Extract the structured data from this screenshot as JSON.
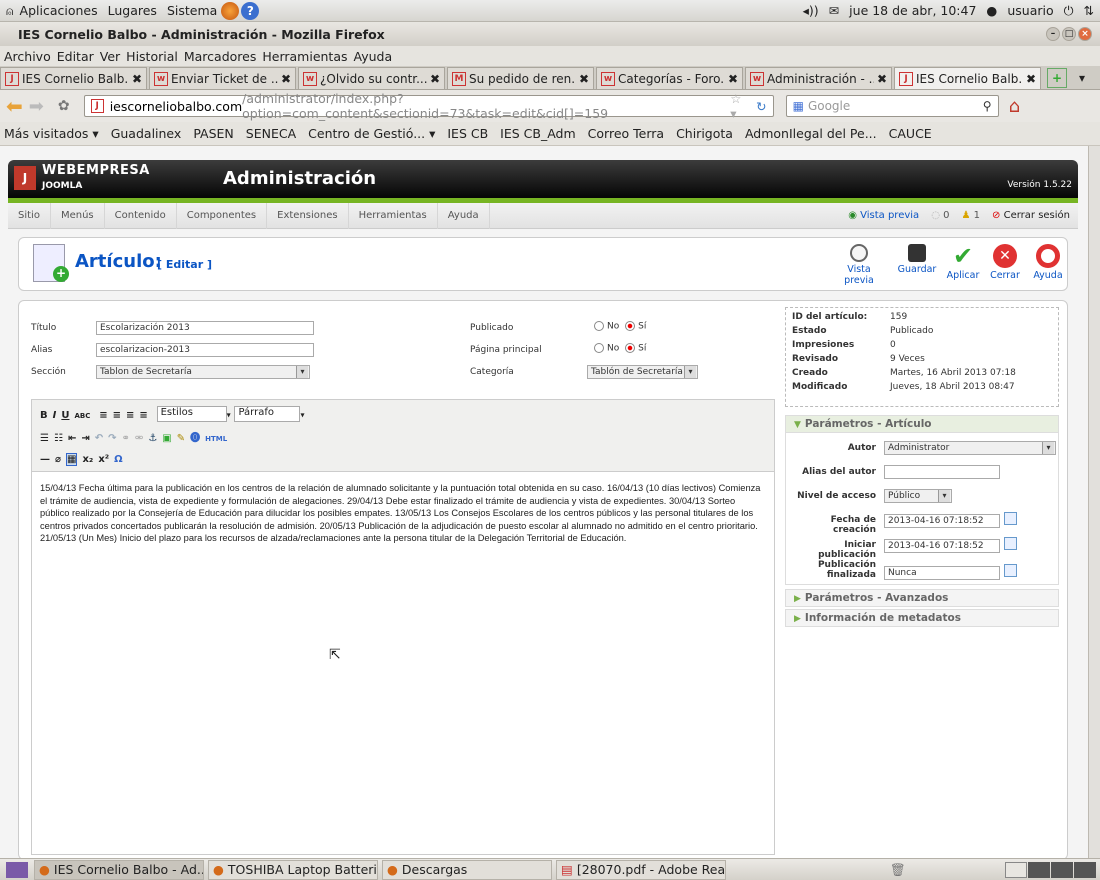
{
  "gnome_panel": {
    "apps": "Aplicaciones",
    "places": "Lugares",
    "system": "Sistema",
    "datetime": "jue 18 de abr, 10:47",
    "user": "usuario"
  },
  "window": {
    "title": "IES Cornelio Balbo - Administración - Mozilla Firefox"
  },
  "firefox_menu": [
    "Archivo",
    "Editar",
    "Ver",
    "Historial",
    "Marcadores",
    "Herramientas",
    "Ayuda"
  ],
  "tabs": [
    "IES Cornelio Balb...",
    "Enviar Ticket de ...",
    "¿Olvido su contr...",
    "Su pedido de ren...",
    "Categorías - Foro...",
    "Administración - ...",
    "IES Cornelio Balb..."
  ],
  "nav": {
    "url_host": "iescorneliobalbo.com",
    "url_path": "/administrator/index.php?option=com_content&sectionid=73&task=edit&cid[]=159",
    "search_placeholder": "Google"
  },
  "bookmarks": [
    "Más visitados ▾",
    "Guadalinex",
    "PASEN",
    "SENECA",
    "Centro de Gestió... ▾",
    "IES CB",
    "IES CB_Adm",
    "Correo Terra",
    "Chirigota",
    "AdmonIlegal del Pe...",
    "CAUCE"
  ],
  "joomla": {
    "brand": "WEBEMPRESA",
    "sub": "JOOMLA",
    "header": "Administración",
    "version": "Versión 1.5.22",
    "menu": [
      "Sitio",
      "Menús",
      "Contenido",
      "Componentes",
      "Extensiones",
      "Herramientas",
      "Ayuda"
    ],
    "preview": "Vista previa",
    "count_a": "0",
    "count_b": "1",
    "logout": "Cerrar sesión"
  },
  "toolbar": {
    "title": "Artículo:",
    "edit": "[ Editar ]",
    "buttons": [
      "Vista previa",
      "Guardar",
      "Aplicar",
      "Cerrar",
      "Ayuda"
    ]
  },
  "form": {
    "titulo_label": "Título",
    "titulo": "Escolarización 2013",
    "alias_label": "Alias",
    "alias": "escolarizacion-2013",
    "seccion_label": "Sección",
    "seccion": "Tablon de Secretaría",
    "publicado_label": "Publicado",
    "pagina_label": "Página principal",
    "categoria_label": "Categoría",
    "categoria": "Tablón de Secretaría",
    "no": "No",
    "si": "Sí"
  },
  "editor": {
    "estilos": "Estilos",
    "parrafo": "Párrafo",
    "text": "15/04/13 Fecha última para la publicación en los centros de la relación de alumnado solicitante y la puntuación total obtenida en su caso. 16/04/13  (10 días lectivos) Comienza el trámite de audiencia, vista de expediente y formulación de alegaciones. 29/04/13 Debe estar finalizado el trámite de audiencia y vista de expedientes. 30/04/13 Sorteo público realizado por la Consejería de Educación para dilucidar los posibles empates. 13/05/13 Los Consejos Escolares de los centros públicos y las personal titulares de los centros privados concertados publicarán la resolución de admisión. 20/05/13 Publicación de la adjudicación de puesto escolar al alumnado no admitido en el centro prioritario. 21/05/13 (Un Mes) Inicio del plazo para los recursos de alzada/reclamaciones ante la persona titular de la Delegación Territorial de Educación."
  },
  "info": [
    [
      "ID del artículo:",
      "159"
    ],
    [
      "Estado",
      "Publicado"
    ],
    [
      "Impresiones",
      "0"
    ],
    [
      "Revisado",
      "9 Veces"
    ],
    [
      "Creado",
      "Martes, 16 Abril 2013 07:18"
    ],
    [
      "Modificado",
      "Jueves, 18 Abril 2013 08:47"
    ]
  ],
  "params": {
    "header": "Parámetros - Artículo",
    "autor_label": "Autor",
    "autor": "Administrator",
    "alias_autor_label": "Alias del autor",
    "nivel_label": "Nivel de acceso",
    "nivel": "Público",
    "fecha_label": "Fecha de creación",
    "fecha": "2013-04-16 07:18:52",
    "iniciar_label": "Iniciar publicación",
    "iniciar": "2013-04-16 07:18:52",
    "fin_label": "Publicación finalizada",
    "fin": "Nunca",
    "avanzados": "Parámetros - Avanzados",
    "metadatos": "Información de metadatos"
  },
  "taskbar": [
    "IES Cornelio Balbo - Ad...",
    "TOSHIBA Laptop Batteri...",
    "Descargas",
    "[28070.pdf - Adobe Rea..."
  ]
}
